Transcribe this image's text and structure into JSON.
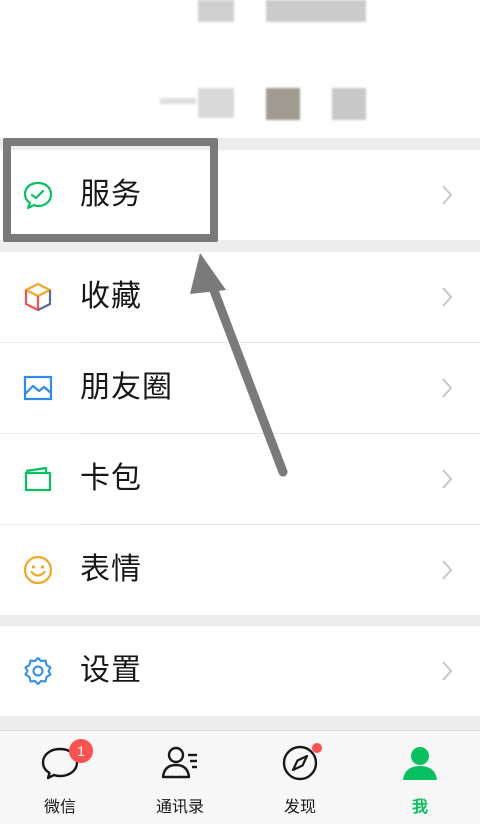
{
  "menu": {
    "service": "服务",
    "favorites": "收藏",
    "moments": "朋友圈",
    "cards": "卡包",
    "stickers": "表情",
    "settings": "设置"
  },
  "tabbar": {
    "chats": "微信",
    "chats_badge": "1",
    "contacts": "通讯录",
    "discover": "发现",
    "me": "我"
  },
  "colors": {
    "accent_green": "#07c160",
    "badge_red": "#fa5151",
    "annotation_gray": "#7a7a7a"
  }
}
